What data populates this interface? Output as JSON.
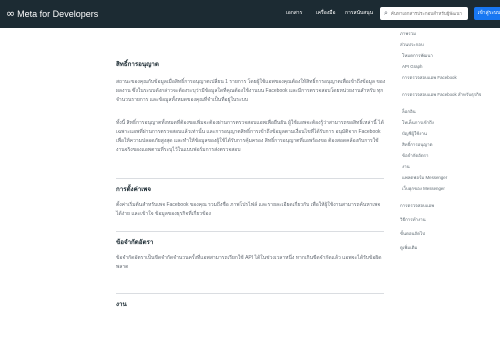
{
  "header": {
    "logo_text": "Meta for Developers",
    "nav": [
      "เอกสาร",
      "เครื่องมือ",
      "การสนับสนุน"
    ],
    "search_placeholder": "ค้นหาเอกสารประกอบสำหรับผู้พัฒนา",
    "cta_label": "เข้าสู่ระบบ"
  },
  "main": {
    "sections": [
      {
        "title": "สิทธิ์การอนุญาต",
        "paragraphs": [
          "สถานะของคุณกับข้อมูลเมื่อสิทธิ์การอนุญาตเปลี่ยน 1 รายการ โดยผู้ใช้แอพของคุณต้องให้สิทธิ์การอนุญาตเพื่อเข้าถึงข้อมูล ของผลงาน ซึ่งในระบบดังกล่าวจะต้องระบุว่ามีข้อมูลใดที่คุณต้องใช้งานบน Facebook และมีการตรวจสอบโดยหน่วยงานสำหรับ ทุกจำนวนรายการ และข้อมูลทั้งหมดของคุณที่จำเป็นที่อยู่ในระบบ",
          "ทั้งนี้ สิทธิ์การอนุญาตทั้งหมดที่ต้องขอเพิ่มจะต้องผ่านการตรวจสอบแอพเพื่อยืนยัน ผู้ใช้แอพจะต้องรู้ว่าสามารถขอสิทธิ์เหล่านี้ ได้เฉพาะแอพที่ผ่านการตรวจสอบแล้วเท่านั้น และการอนุญาตสิทธิ์การเข้าถึงข้อมูลตามเงื่อนไขที่ได้รับการ อนุมัติจาก Facebook เพื่อให้ความปลอดภัยสูงสุด และทำให้ข้อมูลของผู้ใช้ได้รับการคุ้มครอง สิทธิ์การอนุญาตที่แอพร้องขอ ต้องสอดคล้องกับการใช้งานจริงของแอพตามที่ระบุไว้ในแบบฟอร์มการส่งตรวจสอบ"
        ]
      },
      {
        "title": "การตั้งค่าเพจ",
        "paragraphs": [
          "ตั้งค่าเริ่มต้นสำหรับเพจ Facebook ของคุณ รวมถึงชื่อ ภาพโปรไฟล์ และรายละเอียดเกี่ยวกับ เพื่อให้ผู้ใช้งานสามารถค้นหาเพจได้ง่าย และเข้าใจ ข้อมูลของธุรกิจที่เกี่ยวข้อง"
        ]
      },
      {
        "title": "ข้อจำกัดอัตรา",
        "paragraphs": [
          "ข้อจำกัดอัตราเป็นขีดจำกัดจำนวนครั้งที่แอพสามารถเรียกใช้ API ได้ในช่วงเวลาหนึ่ง หากเกินขีดจำกัดแล้ว แอพจะได้รับข้อผิดพลาด"
        ]
      },
      {
        "title": "งาน",
        "paragraphs": []
      }
    ]
  },
  "sidebar": {
    "items": [
      {
        "label": "ภาพรวม",
        "level": "top"
      },
      {
        "label": "ส่วนประกอบ",
        "level": "top"
      },
      {
        "label": "โหมดการพัฒนา",
        "level": "sub"
      },
      {
        "label": "API Graph",
        "level": "sub"
      },
      {
        "label": "การตรวจสอบแอพ Facebook",
        "level": "sub"
      },
      {
        "label": "การตรวจสอบแอพ Facebook สำหรับธุรกิจ",
        "level": "sub"
      },
      {
        "label": "ล็อกอิน",
        "level": "sub"
      },
      {
        "label": "โทเค็นการเข้าถึง",
        "level": "sub"
      },
      {
        "label": "บัญชีผู้ใช้งาน",
        "level": "sub"
      },
      {
        "label": "สิทธิ์การอนุญาต",
        "level": "sub"
      },
      {
        "label": "ข้อจำกัดอัตรา",
        "level": "sub"
      },
      {
        "label": "งาน",
        "level": "sub"
      },
      {
        "label": "แพลตฟอร์ม Messenger",
        "level": "sub"
      },
      {
        "label": "เว็บฮุกของ Messenger",
        "level": "sub"
      },
      {
        "label": "การตรวจสอบแอพ",
        "level": "top"
      },
      {
        "label": "วิธีการทำงาน",
        "level": "top"
      },
      {
        "label": "ขั้นตอนถัดไป",
        "level": "top"
      },
      {
        "label": "ดูเพิ่มเติม",
        "level": "top"
      }
    ]
  },
  "colors": {
    "topbar": "#1c2b33",
    "cta": "#1877f2",
    "body_text": "#606770",
    "heading": "#1c2b33"
  }
}
